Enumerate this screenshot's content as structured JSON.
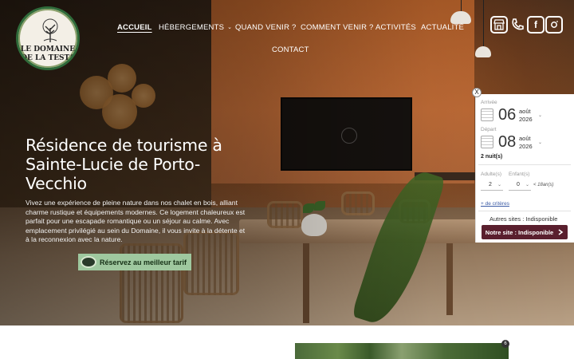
{
  "logo": {
    "line1": "LE DOMAINE",
    "line2": "DE LA TESTA"
  },
  "nav": {
    "items": [
      {
        "label": "ACCUEIL",
        "active": true
      },
      {
        "label": "HÉBERGEMENTS",
        "has_dropdown": true
      },
      {
        "label": "QUAND VENIR ?"
      },
      {
        "label": "COMMENT VENIR ?"
      },
      {
        "label": "ACTIVITÉS"
      },
      {
        "label": "ACTUALITÉ"
      },
      {
        "label": "CONTACT"
      }
    ],
    "dropdown_caret": "⌄"
  },
  "social": {
    "icons": [
      "shop-icon",
      "phone-icon",
      "facebook-icon",
      "instagram-icon"
    ]
  },
  "hero": {
    "title": "Résidence de tourisme à Sainte-Lucie de Porto-Vecchio",
    "description": "Vivez une expérience de pleine nature dans nos chalet en bois, alliant charme rustique et équipements modernes. Ce logement chaleureux est parfait pour une escapade romantique ou un séjour au calme. Avec emplacement privilégié au sein du Domaine, il vous invite à la détente et à la reconnexion avec la nature.",
    "cta_label": "Réservez au meilleur tarif"
  },
  "booking": {
    "close_label": "X",
    "arrival_label": "Arrivée",
    "arrival_day": "06",
    "arrival_month": "août",
    "arrival_year": "2026",
    "departure_label": "Départ",
    "departure_day": "08",
    "departure_month": "août",
    "departure_year": "2026",
    "nights": "2 nuit(s)",
    "adults_label": "Adulte(s)",
    "adults_value": "2",
    "children_label": "Enfant(s)",
    "children_value": "0",
    "children_note": "< 18an(s)",
    "more_criteria": "+ de critères",
    "other_sites": "Autres sites : Indisponible",
    "our_site": "Notre site : Indisponible",
    "caret": "⌄"
  },
  "below": {
    "badge": "6"
  },
  "colors": {
    "cta_bg": "#9fc89f",
    "site_button": "#5a1f2e",
    "logo_ring": "#2f6b3a"
  }
}
